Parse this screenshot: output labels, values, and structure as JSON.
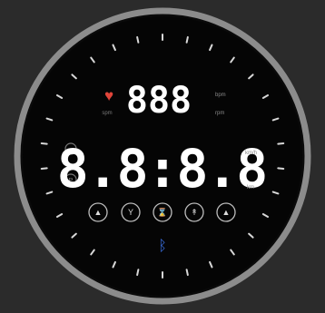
{
  "display": {
    "heart_icon": "heart-icon",
    "top_readout": "888",
    "top_unit_1": "bpm",
    "top_unit_2": "rpm",
    "top_left_label": "spm",
    "main_readout": "8.8:8.8",
    "main_unit_top": "km/h",
    "main_unit_bottom": "km",
    "left_marker_top": "m",
    "left_marker_bottom": "P",
    "bluetooth_icon": "bluetooth-icon",
    "buttons": [
      {
        "icon": "speed-up-icon",
        "label": ""
      },
      {
        "icon": "grade-icon",
        "label": ""
      },
      {
        "icon": "timer-icon",
        "label": ""
      },
      {
        "icon": "person-icon",
        "label": ""
      },
      {
        "icon": "upload-icon",
        "label": ""
      }
    ]
  },
  "colors": {
    "background": "#2b2b2b",
    "bezel": "#8f8f8f",
    "face": "#050505",
    "digit": "#ffffff",
    "dim": "#9a9a9a",
    "heart": "#e0453a",
    "bluetooth": "#3a6fe0"
  }
}
